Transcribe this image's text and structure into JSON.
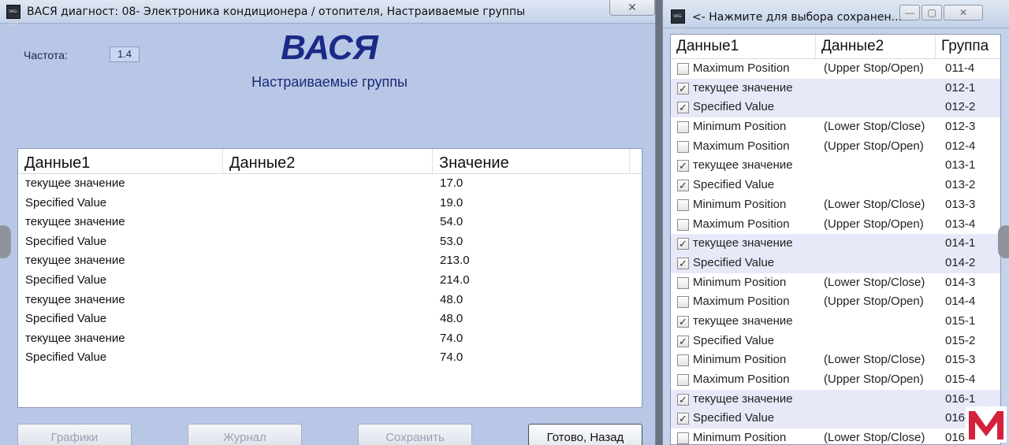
{
  "main_window": {
    "title": "ВАСЯ диагност: 08- Электроника кондиционера / отопителя,  Настраиваемые группы",
    "icon_text": "VAG-COM",
    "close_glyph": "✕",
    "frequency_label": "Частота:",
    "frequency_value": "1.4",
    "brand": "ВАСЯ",
    "subtitle": "Настраиваемые группы",
    "columns": [
      "Данные1",
      "Данные2",
      "Значение"
    ],
    "rows": [
      {
        "d1": "текущее значение",
        "d2": "",
        "value": "17.0"
      },
      {
        "d1": "Specified Value",
        "d2": "",
        "value": "19.0"
      },
      {
        "d1": "текущее значение",
        "d2": "",
        "value": "54.0"
      },
      {
        "d1": "Specified Value",
        "d2": "",
        "value": "53.0"
      },
      {
        "d1": "текущее значение",
        "d2": "",
        "value": "213.0"
      },
      {
        "d1": "Specified Value",
        "d2": "",
        "value": "214.0"
      },
      {
        "d1": "текущее значение",
        "d2": "",
        "value": "48.0"
      },
      {
        "d1": "Specified Value",
        "d2": "",
        "value": "48.0"
      },
      {
        "d1": "текущее значение",
        "d2": "",
        "value": "74.0"
      },
      {
        "d1": "Specified Value",
        "d2": "",
        "value": "74.0"
      }
    ],
    "buttons": {
      "graphs": "Графики",
      "journal": "Журнал",
      "save": "Сохранить",
      "done": "Готово, Назад"
    }
  },
  "side_window": {
    "title": "<- Нажмите для выбора сохранен...",
    "icon_text": "VAG-COM",
    "minimize_glyph": "—",
    "maximize_glyph": "▢",
    "close_glyph": "✕",
    "columns": [
      "Данные1",
      "Данные2",
      "Группа"
    ],
    "rows": [
      {
        "checked": false,
        "d1": "Maximum Position",
        "d2": "(Upper Stop/Open)",
        "group": "011-4",
        "selected": false
      },
      {
        "checked": true,
        "d1": "текущее значение",
        "d2": "",
        "group": "012-1",
        "selected": true
      },
      {
        "checked": true,
        "d1": "Specified Value",
        "d2": "",
        "group": "012-2",
        "selected": true
      },
      {
        "checked": false,
        "d1": "Minimum Position",
        "d2": "(Lower Stop/Close)",
        "group": "012-3",
        "selected": false
      },
      {
        "checked": false,
        "d1": "Maximum Position",
        "d2": "(Upper Stop/Open)",
        "group": "012-4",
        "selected": false
      },
      {
        "checked": true,
        "d1": "текущее значение",
        "d2": "",
        "group": "013-1",
        "selected": false
      },
      {
        "checked": true,
        "d1": "Specified Value",
        "d2": "",
        "group": "013-2",
        "selected": false
      },
      {
        "checked": false,
        "d1": "Minimum Position",
        "d2": "(Lower Stop/Close)",
        "group": "013-3",
        "selected": false
      },
      {
        "checked": false,
        "d1": "Maximum Position",
        "d2": "(Upper Stop/Open)",
        "group": "013-4",
        "selected": false
      },
      {
        "checked": true,
        "d1": "текущее значение",
        "d2": "",
        "group": "014-1",
        "selected": true
      },
      {
        "checked": true,
        "d1": "Specified Value",
        "d2": "",
        "group": "014-2",
        "selected": true
      },
      {
        "checked": false,
        "d1": "Minimum Position",
        "d2": "(Lower Stop/Close)",
        "group": "014-3",
        "selected": false
      },
      {
        "checked": false,
        "d1": "Maximum Position",
        "d2": "(Upper Stop/Open)",
        "group": "014-4",
        "selected": false
      },
      {
        "checked": true,
        "d1": "текущее значение",
        "d2": "",
        "group": "015-1",
        "selected": false
      },
      {
        "checked": true,
        "d1": "Specified Value",
        "d2": "",
        "group": "015-2",
        "selected": false
      },
      {
        "checked": false,
        "d1": "Minimum Position",
        "d2": "(Lower Stop/Close)",
        "group": "015-3",
        "selected": false
      },
      {
        "checked": false,
        "d1": "Maximum Position",
        "d2": "(Upper Stop/Open)",
        "group": "015-4",
        "selected": false
      },
      {
        "checked": true,
        "d1": "текущее значение",
        "d2": "",
        "group": "016-1",
        "selected": true
      },
      {
        "checked": true,
        "d1": "Specified Value",
        "d2": "",
        "group": "016-2",
        "selected": true
      },
      {
        "checked": false,
        "d1": "Minimum Position",
        "d2": "(Lower Stop/Close)",
        "group": "016-3",
        "selected": false
      }
    ]
  },
  "colors": {
    "window_bg": "#b9c7e6",
    "brand_blue": "#1a2a86",
    "selection_row": "#e7e9f8",
    "logo_red": "#d4213d"
  },
  "checkmark_glyph": "✓"
}
